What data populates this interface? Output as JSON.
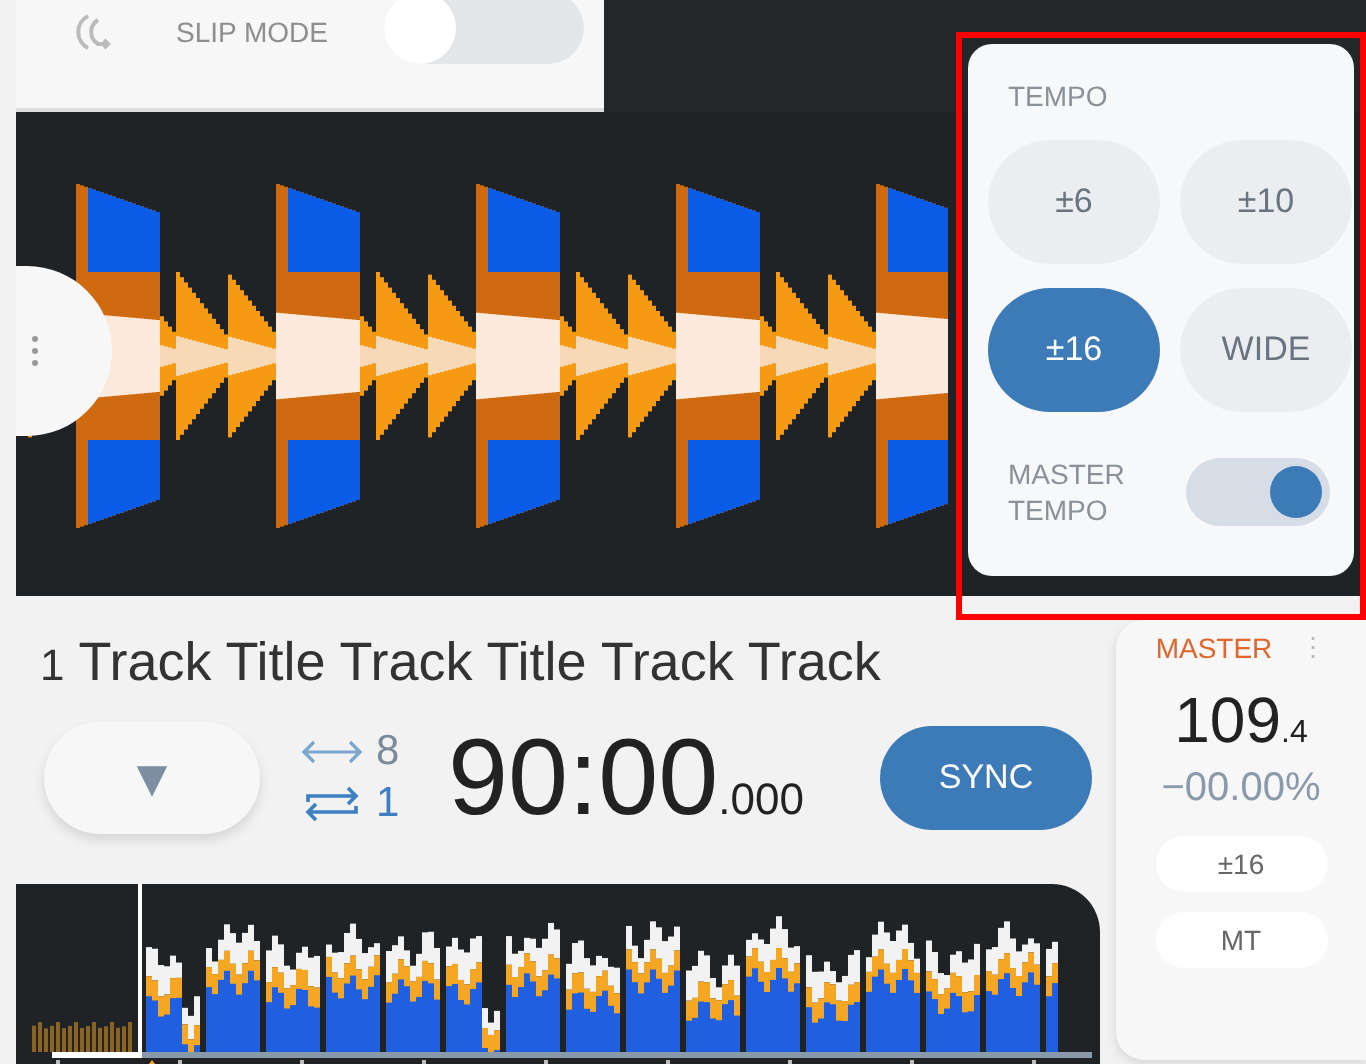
{
  "slip_mode": {
    "label": "SLIP MODE",
    "on": false
  },
  "tempo_popup": {
    "title": "TEMPO",
    "ranges": [
      {
        "label": "±6",
        "selected": false
      },
      {
        "label": "±10",
        "selected": false
      },
      {
        "label": "±16",
        "selected": true
      },
      {
        "label": "WIDE",
        "selected": false
      }
    ],
    "master_tempo": {
      "label": "MASTER TEMPO",
      "on": true
    }
  },
  "track": {
    "number": "1",
    "title": "Track Title Track Title Track Track"
  },
  "transport": {
    "cue_symbol": "▼",
    "beat_jump": "8",
    "loop": "1",
    "time": "90:00",
    "time_ms": ".000",
    "sync": "SYNC"
  },
  "master_panel": {
    "label": "MASTER",
    "menu": "⋮",
    "bpm": "109",
    "bpm_decimal": ".4",
    "pitch": "−00.00%",
    "range": "±16",
    "master_tempo": "MT"
  }
}
